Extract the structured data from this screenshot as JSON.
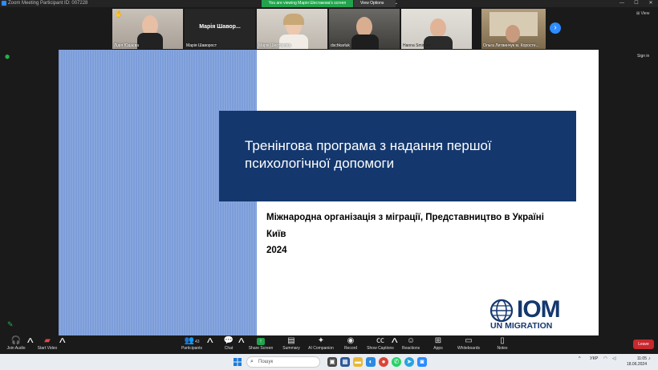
{
  "titlebar": {
    "title": "Zoom Meeting  Participant ID: 007228",
    "minimize": "—",
    "maximize": "☐",
    "close": "✕"
  },
  "banner": {
    "text": "You are viewing Марія Шестакова's screen",
    "view_options": "View Options",
    "chevron": "⌄"
  },
  "thumbnails": [
    {
      "name": "Лідія Юдаєва",
      "raise_hand": "✋"
    },
    {
      "name": "Марія Шаворост",
      "center_label": "Марія Шавор..."
    },
    {
      "name": "Марія Шестакова"
    },
    {
      "name": "dschkarluk"
    },
    {
      "name": "Hanna Smirnov"
    },
    {
      "name": "Ольга Литвинчук м. Коросте..."
    }
  ],
  "next_arrow": "›",
  "view_label": "⊞ View",
  "sign_in": "Sign in",
  "slide": {
    "title": "Тренінгова програма з надання першої психологічної допомоги",
    "lines": [
      "Міжнародна організація з міграції, Представництво в Україні",
      "Київ",
      "2024"
    ],
    "logo_text": "IOM",
    "logo_sub": "UN MIGRATION",
    "colors": {
      "navy": "#14386e",
      "stripe": "#7c9dd9"
    }
  },
  "toolbar": {
    "join_audio": "Join Audio",
    "start_video": "Start Video",
    "participants": "Participants",
    "participants_count": "43",
    "chat": "Chat",
    "share_screen": "Share Screen",
    "summary": "Summary",
    "ai_companion": "AI Companion",
    "record": "Record",
    "show_captions": "Show Captions",
    "reactions": "Reactions",
    "apps": "Apps",
    "whiteboards": "Whiteboards",
    "notes": "Notes",
    "leave": "Leave",
    "caret": "^"
  },
  "taskbar": {
    "search_placeholder": "Пошук",
    "lang": "УКР",
    "time": "11:05",
    "date": "18.06.2024",
    "tray_up": "^"
  }
}
